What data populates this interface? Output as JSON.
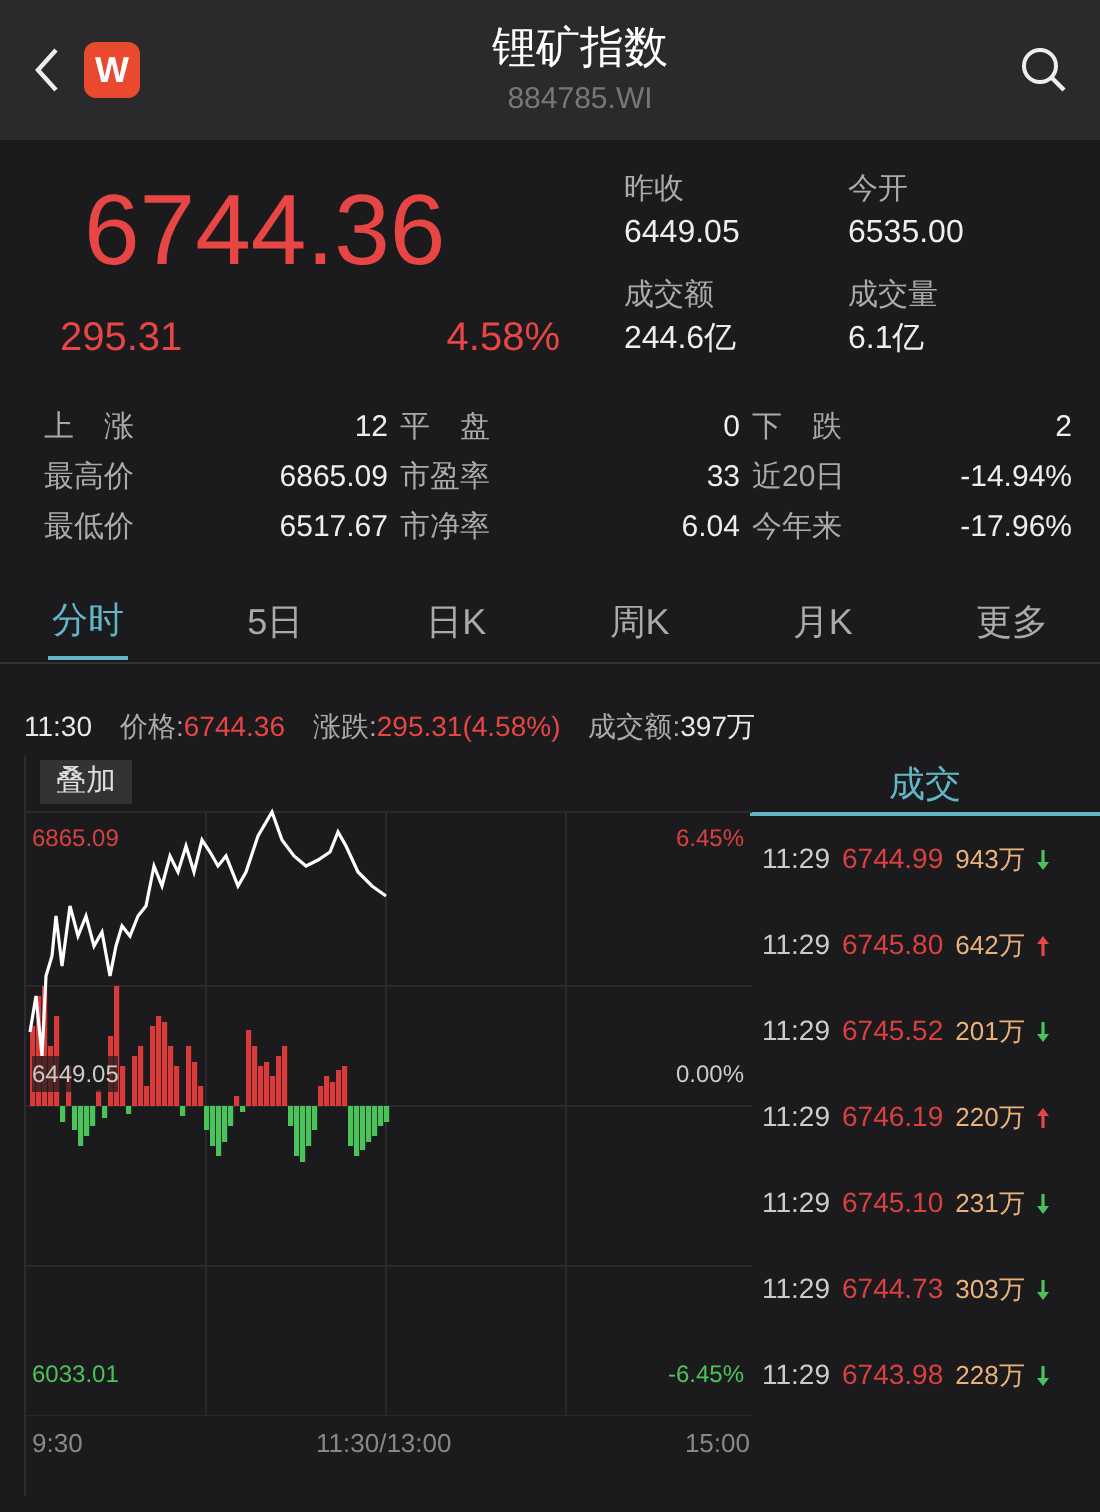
{
  "header": {
    "title": "锂矿指数",
    "code": "884785.WI",
    "logo": "W"
  },
  "quote": {
    "price": "6744.36",
    "change": "295.31",
    "change_pct": "4.58%",
    "fields": [
      {
        "label": "昨收",
        "value": "6449.05"
      },
      {
        "label": "今开",
        "value": "6535.00"
      },
      {
        "label": "成交额",
        "value": "244.6亿"
      },
      {
        "label": "成交量",
        "value": "6.1亿"
      }
    ]
  },
  "stats": [
    [
      {
        "label": "上　涨",
        "value": "12"
      },
      {
        "label": "平　盘",
        "value": "0"
      },
      {
        "label": "下　跌",
        "value": "2"
      }
    ],
    [
      {
        "label": "最高价",
        "value": "6865.09"
      },
      {
        "label": "市盈率",
        "value": "33"
      },
      {
        "label": "近20日",
        "value": "-14.94%"
      }
    ],
    [
      {
        "label": "最低价",
        "value": "6517.67"
      },
      {
        "label": "市净率",
        "value": "6.04"
      },
      {
        "label": "今年来",
        "value": "-17.96%"
      }
    ]
  ],
  "tabs": [
    {
      "label": "分时",
      "selected": true
    },
    {
      "label": "5日",
      "selected": false
    },
    {
      "label": "日K",
      "selected": false
    },
    {
      "label": "周K",
      "selected": false
    },
    {
      "label": "月K",
      "selected": false
    },
    {
      "label": "更多",
      "selected": false
    }
  ],
  "info": {
    "time": "11:30",
    "items": [
      {
        "label": "价格:",
        "value": "6744.36",
        "kind": "rise"
      },
      {
        "label": "涨跌:",
        "value": "295.31(4.58%)",
        "kind": "rise"
      },
      {
        "label": "成交额:",
        "value": "397万",
        "kind": "plain"
      }
    ]
  },
  "chart": {
    "overlay_button": "叠加",
    "high": "6865.09",
    "high_pct": "6.45%",
    "base": "6449.05",
    "base_pct": "0.00%",
    "low": "6033.01",
    "low_pct": "-6.45%",
    "times": [
      "9:30",
      "11:30/13:00",
      "15:00"
    ]
  },
  "trades": {
    "title": "成交",
    "rows": [
      {
        "time": "11:29",
        "price": "6744.99",
        "volume": "943万",
        "kind": "fall"
      },
      {
        "time": "11:29",
        "price": "6745.80",
        "volume": "642万",
        "kind": "rise"
      },
      {
        "time": "11:29",
        "price": "6745.52",
        "volume": "201万",
        "kind": "fall"
      },
      {
        "time": "11:29",
        "price": "6746.19",
        "volume": "220万",
        "kind": "rise"
      },
      {
        "time": "11:29",
        "price": "6745.10",
        "volume": "231万",
        "kind": "fall"
      },
      {
        "time": "11:29",
        "price": "6744.73",
        "volume": "303万",
        "kind": "fall"
      },
      {
        "time": "11:29",
        "price": "6743.98",
        "volume": "228万",
        "kind": "fall"
      }
    ]
  }
}
